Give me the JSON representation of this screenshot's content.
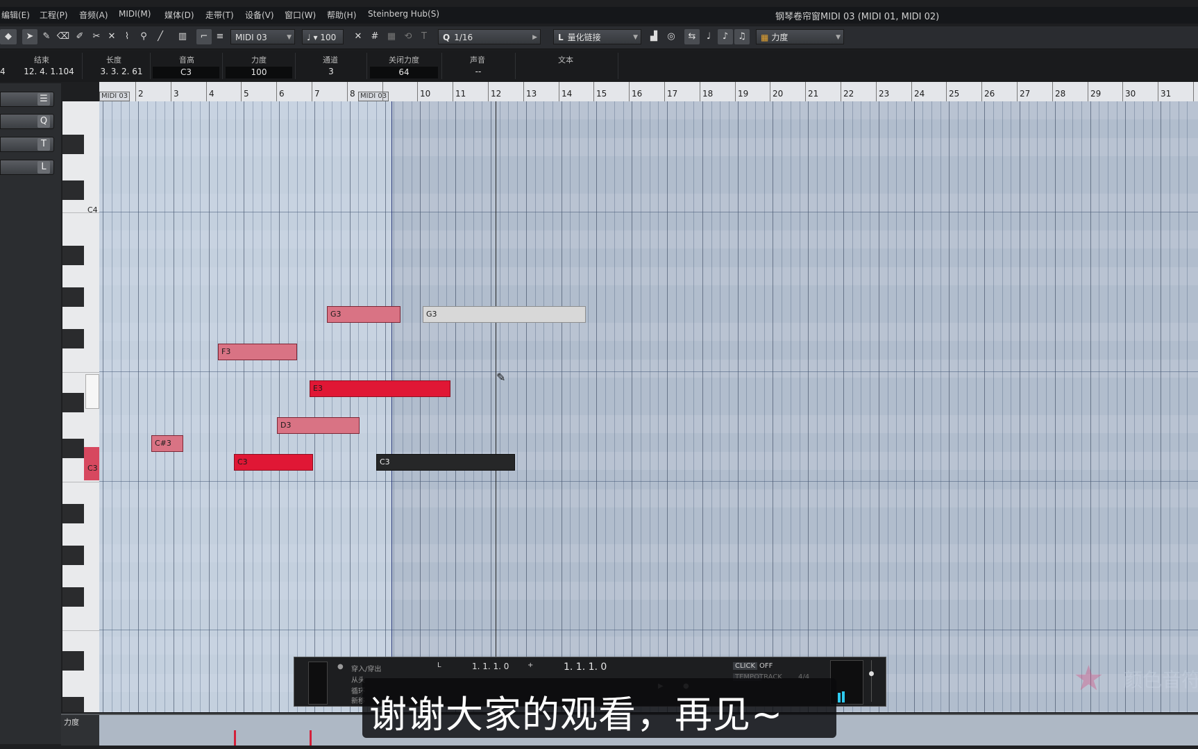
{
  "menu": {
    "items": [
      "编辑(E)",
      "工程(P)",
      "音频(A)",
      "MIDI(M)",
      "媒体(D)",
      "走带(T)",
      "设备(V)",
      "窗口(W)",
      "帮助(H)",
      "Steinberg Hub(S)"
    ],
    "window_title": "钢琴卷帘窗MIDI 03 (MIDI 01, MIDI 02)"
  },
  "toolbar": {
    "part_select": "MIDI 03",
    "velocity_value": "100",
    "quantize_label": "Q",
    "quantize_value": "1/16",
    "length_label": "L",
    "length_value": "量化链接",
    "controller_lane": "力度"
  },
  "infoline": {
    "headers": {
      "end": "结束",
      "length": "长度",
      "pitch": "音高",
      "velocity": "力度",
      "channel": "通道",
      "off_velocity": "关闭力度",
      "voice": "声音",
      "text": "文本"
    },
    "values": {
      "start_partial": "4",
      "end": "12. 4. 1.104",
      "length": "3. 3. 2. 61",
      "pitch": "C3",
      "velocity": "100",
      "channel": "3",
      "off_velocity": "64",
      "voice": "--"
    }
  },
  "sidebar": {
    "buttons": [
      {
        "icon": "☰"
      },
      {
        "icon": "Q"
      },
      {
        "icon": "T"
      },
      {
        "icon": "L"
      }
    ]
  },
  "keyboard": {
    "labels": {
      "c4": "C4",
      "c3": "C3"
    }
  },
  "ruler": {
    "bars": [
      "2",
      "3",
      "4",
      "5",
      "6",
      "7",
      "8",
      "10",
      "11",
      "12",
      "13",
      "14",
      "15",
      "16",
      "17",
      "18",
      "19",
      "20",
      "21",
      "22",
      "23",
      "24",
      "25",
      "26",
      "27",
      "28",
      "29",
      "30",
      "31"
    ],
    "part_tag_1": "MIDI 03",
    "part_tag_2": "MIDI 03"
  },
  "notes": [
    {
      "label": "G3",
      "style": "pink"
    },
    {
      "label": "G3",
      "style": "ghost"
    },
    {
      "label": "F3",
      "style": "pink"
    },
    {
      "label": "E3",
      "style": "red"
    },
    {
      "label": "D3",
      "style": "pink"
    },
    {
      "label": "C#3",
      "style": "pink"
    },
    {
      "label": "C3",
      "style": "red"
    },
    {
      "label": "C3",
      "style": "dark"
    }
  ],
  "controller_lane": {
    "label": "力度"
  },
  "transport": {
    "punch_label": "穿入/穿出",
    "from_label": "从头",
    "mode_label": "循环",
    "new_label": "新移",
    "left_locator": "1. 1. 1.   0",
    "position": "1. 1. 1.   0",
    "click_label": "CLICK",
    "click_value": "OFF",
    "tempo_label": "TEMPO",
    "tempo_value": "TRACK",
    "signature": "4/4"
  },
  "subtitle": "谢谢大家的观看，再见~",
  "watermark": "颜色音符"
}
